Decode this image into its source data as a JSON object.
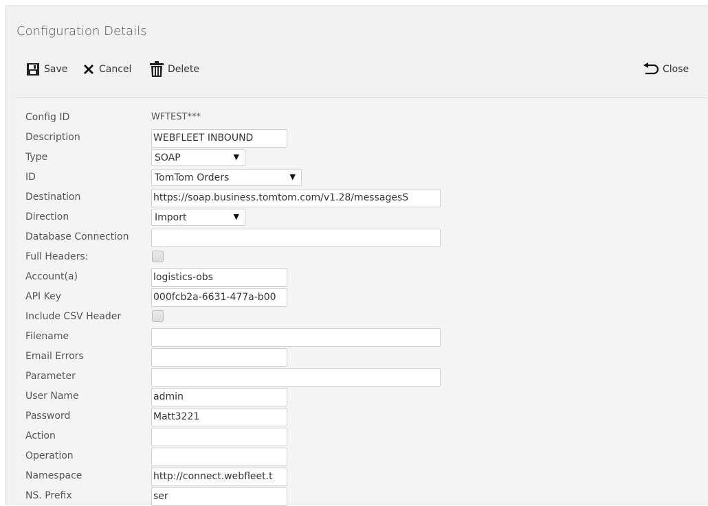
{
  "panel": {
    "title": "Configuration Details"
  },
  "toolbar": {
    "save_label": "Save",
    "cancel_label": "Cancel",
    "delete_label": "Delete",
    "close_label": "Close",
    "icons": {
      "save": "save-icon",
      "cancel": "x-icon",
      "delete": "trash-icon",
      "close": "undo-arrow-icon"
    }
  },
  "form": {
    "config_id": {
      "label": "Config ID",
      "value": "WFTEST***"
    },
    "description": {
      "label": "Description",
      "value": "WEBFLEET INBOUND"
    },
    "type": {
      "label": "Type",
      "value": "SOAP"
    },
    "id": {
      "label": "ID",
      "value": "TomTom Orders"
    },
    "destination": {
      "label": "Destination",
      "value": "https://soap.business.tomtom.com/v1.28/messagesS"
    },
    "direction": {
      "label": "Direction",
      "value": "Import"
    },
    "database_connection": {
      "label": "Database Connection",
      "value": ""
    },
    "full_headers": {
      "label": "Full Headers:",
      "checked": false
    },
    "account": {
      "label": "Account(a)",
      "value": "logistics-obs"
    },
    "api_key": {
      "label": "API Key",
      "value": "000fcb2a-6631-477a-b00"
    },
    "include_csv_header": {
      "label": "Include CSV Header",
      "checked": false
    },
    "filename": {
      "label": "Filename",
      "value": ""
    },
    "email_errors": {
      "label": "Email Errors",
      "value": ""
    },
    "parameter": {
      "label": "Parameter",
      "value": ""
    },
    "user_name": {
      "label": "User Name",
      "value": "admin"
    },
    "password": {
      "label": "Password",
      "value": "Matt3221"
    },
    "action": {
      "label": "Action",
      "value": ""
    },
    "operation": {
      "label": "Operation",
      "value": ""
    },
    "namespace": {
      "label": "Namespace",
      "value": "http://connect.webfleet.t"
    },
    "ns_prefix": {
      "label": "NS. Prefix",
      "value": "ser"
    }
  }
}
